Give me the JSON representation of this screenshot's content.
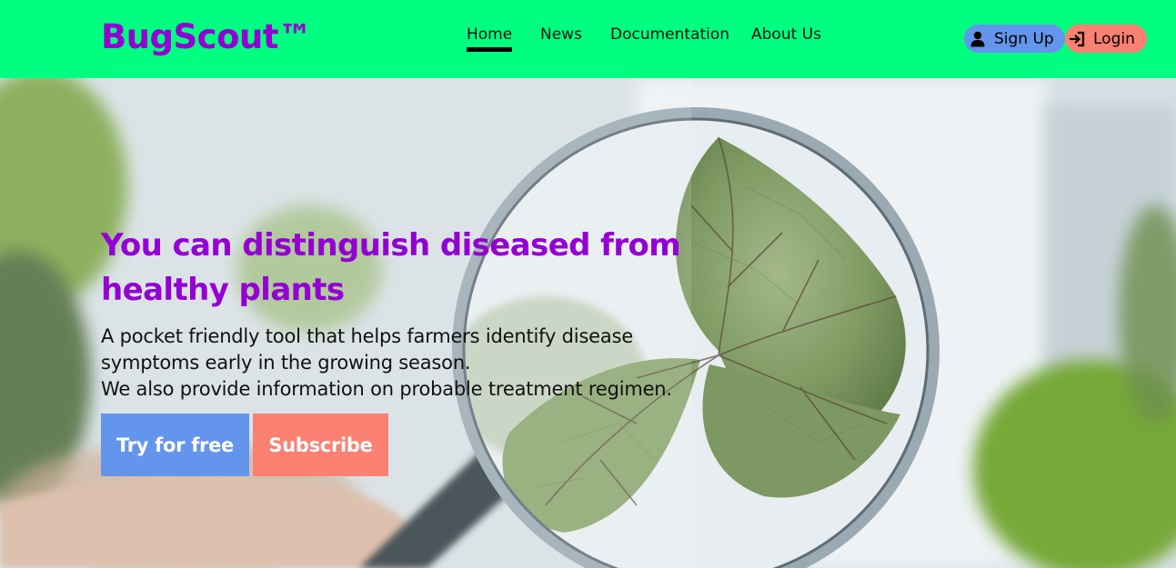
{
  "header": {
    "logo": "BugScout™",
    "nav": [
      {
        "label": "Home",
        "active": true
      },
      {
        "label": "News",
        "active": false
      },
      {
        "label": "Documentation",
        "active": false
      },
      {
        "label": "About Us",
        "active": false
      }
    ],
    "signup_label": "Sign Up",
    "login_label": "Login"
  },
  "hero": {
    "title": "You can distinguish diseased from healthy plants",
    "description_lines": [
      "A pocket friendly tool that helps farmers identify disease",
      "symptoms early in the growing season.",
      "We also provide information on probable treatment regimen."
    ],
    "try_label": "Try for free",
    "subscribe_label": "Subscribe"
  },
  "colors": {
    "header_bg": "#00ff80",
    "brand": "#9400d3",
    "primary_button": "#6495ed",
    "secondary_button": "#fa8072"
  },
  "icons": {
    "signup": "user-icon",
    "login": "login-arrow-icon"
  }
}
